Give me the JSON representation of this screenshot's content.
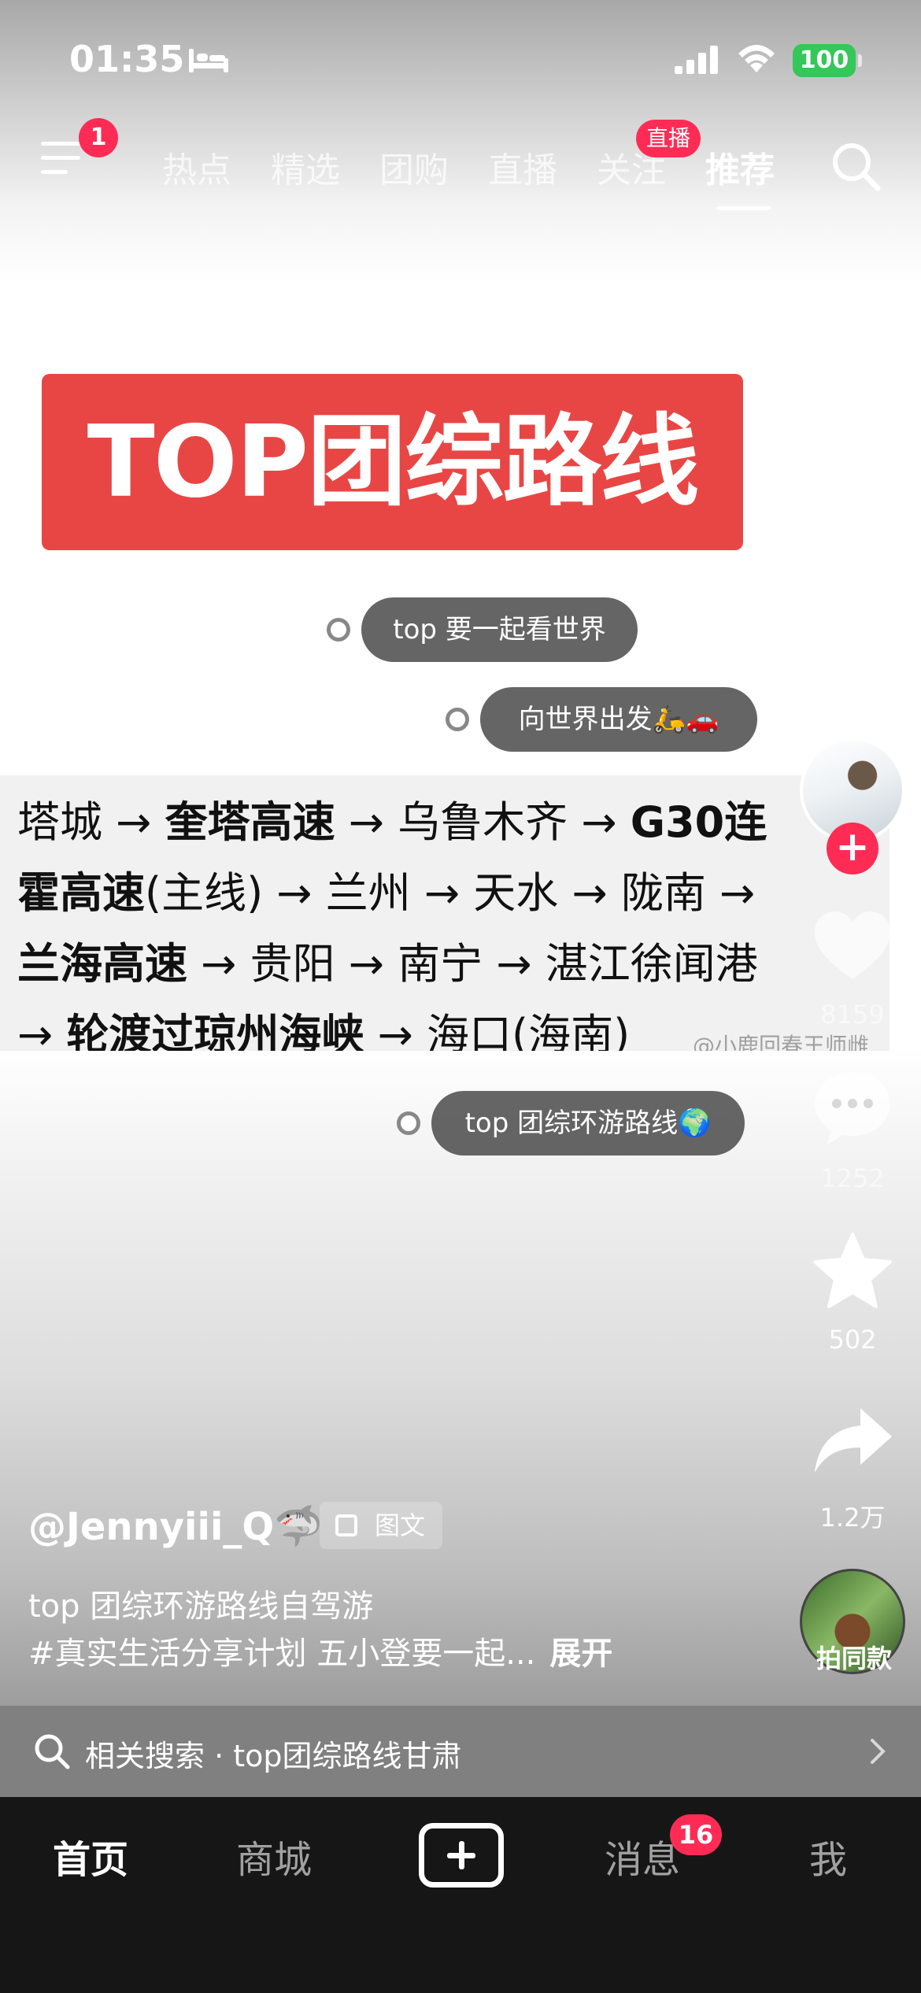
{
  "status_bar": {
    "time": "01:35",
    "battery": "100"
  },
  "top_nav": {
    "menu_badge": "1",
    "tabs": [
      "热点",
      "精选",
      "团购",
      "直播",
      "关注",
      "推荐"
    ],
    "live_badge": "直播"
  },
  "post": {
    "banner_title": "TOP团综路线",
    "tags": [
      "top 要一起看世界",
      "向世界出发🛵🚗",
      "top 团综环游路线🌍"
    ],
    "route_lines": [
      [
        {
          "t": "塔城 → ",
          "b": false
        },
        {
          "t": "奎塔高速",
          "b": true
        },
        {
          "t": " → 乌鲁木齐 → ",
          "b": false
        },
        {
          "t": "G30连",
          "b": true
        }
      ],
      [
        {
          "t": "霍高速",
          "b": true
        },
        {
          "t": "(主线) → 兰州 → 天水 → 陇南 →",
          "b": false
        }
      ],
      [
        {
          "t": "兰海高速",
          "b": true
        },
        {
          "t": " → 贵阳 → 南宁 → 湛江徐闻港",
          "b": false
        }
      ],
      [
        {
          "t": "→ ",
          "b": false
        },
        {
          "t": "轮渡过琼州海峡",
          "b": true
        },
        {
          "t": " → 海口(海南)",
          "b": false
        }
      ]
    ],
    "watermark": "@小鹿回春王师雌"
  },
  "sidebar": {
    "likes": "8159",
    "comments": "1252",
    "favorites": "502",
    "shares": "1.2万",
    "music_label": "拍同款"
  },
  "caption": {
    "author": "@Jennyiii_Q",
    "author_emoji": "🦈",
    "type_badge": "图文",
    "line1": "top 团综环游路线自驾游",
    "line2": "#真实生活分享计划 五小登要一起...",
    "expand": "展开"
  },
  "related_search": {
    "text": "相关搜索 · top团综路线甘肃"
  },
  "tab_bar": {
    "home": "首页",
    "mall": "商城",
    "messages": "消息",
    "message_badge": "16",
    "me": "我"
  },
  "colors": {
    "accent": "#fe2c55",
    "banner": "#e84645",
    "battery": "#34c759",
    "tab_bar": "#161616"
  }
}
